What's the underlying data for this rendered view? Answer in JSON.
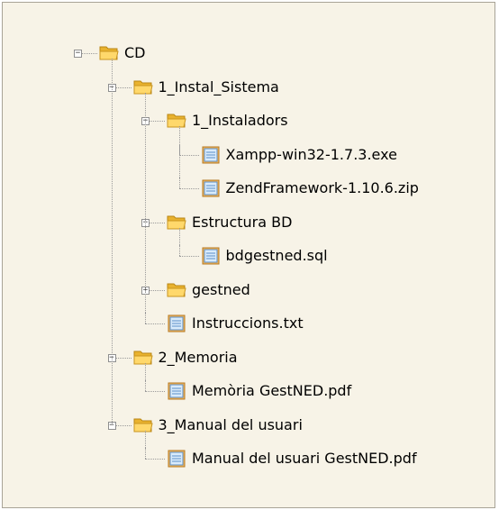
{
  "tree": {
    "nodes": [
      {
        "label": "CD",
        "depth": 0,
        "type": "folder",
        "expander": "⊟"
      },
      {
        "label": "1_Instal_Sistema",
        "depth": 1,
        "type": "folder",
        "expander": "⊟"
      },
      {
        "label": "1_Instaladors",
        "depth": 2,
        "type": "folder",
        "expander": "⊟"
      },
      {
        "label": "Xampp-win32-1.7.3.exe",
        "depth": 3,
        "type": "file",
        "expander": ""
      },
      {
        "label": "ZendFramework-1.10.6.zip",
        "depth": 3,
        "type": "file",
        "expander": ""
      },
      {
        "label": "Estructura BD",
        "depth": 2,
        "type": "folder",
        "expander": "⊟"
      },
      {
        "label": "bdgestned.sql",
        "depth": 3,
        "type": "file",
        "expander": ""
      },
      {
        "label": "gestned",
        "depth": 2,
        "type": "folder",
        "expander": "⊞"
      },
      {
        "label": "Instruccions.txt",
        "depth": 2,
        "type": "file",
        "expander": ""
      },
      {
        "label": "2_Memoria",
        "depth": 1,
        "type": "folder",
        "expander": "⊟"
      },
      {
        "label": "Memòria GestNED.pdf",
        "depth": 2,
        "type": "file",
        "expander": ""
      },
      {
        "label": "3_Manual del usuari",
        "depth": 1,
        "type": "folder",
        "expander": "⊟"
      },
      {
        "label": "Manual del usuari GestNED.pdf",
        "depth": 2,
        "type": "file",
        "expander": ""
      }
    ]
  },
  "icons": {
    "folder": "folder-icon",
    "file": "file-icon"
  },
  "colors": {
    "panel_bg": "#f7f3e7",
    "border": "#a8a397",
    "folder": "#f5c542",
    "file": "#6fa8dc"
  }
}
